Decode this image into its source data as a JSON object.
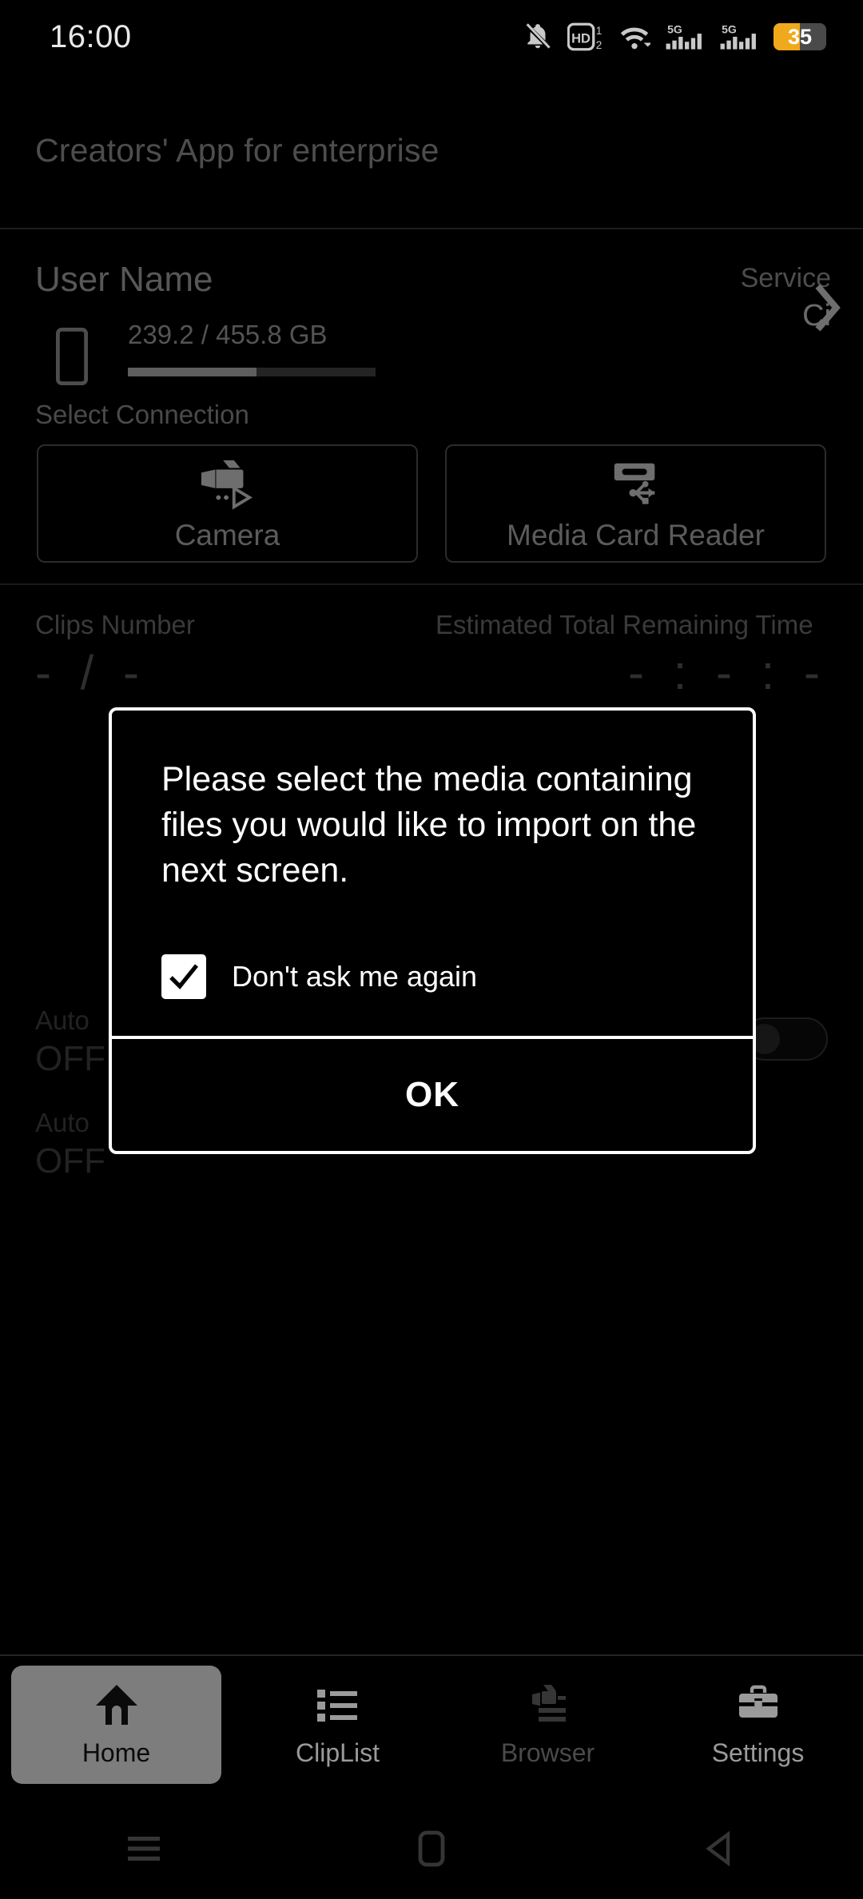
{
  "status_bar": {
    "clock": "16:00",
    "battery_percent": "35",
    "battery_fill_pct": 50,
    "icons": [
      "bell-mute-icon",
      "hd-dual-sim-icon",
      "wifi-icon",
      "signal-5g-icon",
      "signal-5g-icon",
      "battery-icon"
    ],
    "hd_label": "HD",
    "sim_one": "1",
    "sim_two": "2",
    "network_label": "5G",
    "battery_color": "#f0a91c"
  },
  "header": {
    "app_title": "Creators' App for enterprise"
  },
  "user": {
    "name": "User Name",
    "storage_text": "239.2 / 455.8 GB",
    "storage_used_pct": 52,
    "service_label": "Service",
    "service_value": "Ci",
    "chevron_icon": "chevron-right-icon",
    "phone_icon": "phone-storage-icon"
  },
  "connection": {
    "section_label": "Select Connection",
    "options": [
      {
        "label": "Camera",
        "icon": "camcorder-icon"
      },
      {
        "label": "Media Card Reader",
        "icon": "card-reader-usb-icon"
      }
    ]
  },
  "stats": {
    "clips_label": "Clips Number",
    "clips_value": "- / -",
    "time_label": "Estimated Total Remaining Time",
    "time_value": "- : - : -"
  },
  "auto_rows": [
    {
      "label": "Auto",
      "value": "OFF",
      "toggle_state": "off"
    },
    {
      "label": "Auto",
      "value": "OFF",
      "toggle_state": "off"
    }
  ],
  "dialog": {
    "message": "Please select the media containing files you would like to import on the next screen.",
    "checkbox_label": "Don't ask me again",
    "checkbox_checked": true,
    "checkbox_icon": "checkmark-icon",
    "ok_label": "OK",
    "border_color": "#ffffff"
  },
  "bottom_nav": {
    "items": [
      {
        "label": "Home",
        "icon": "home-icon",
        "state": "active"
      },
      {
        "label": "ClipList",
        "icon": "list-icon",
        "state": "normal"
      },
      {
        "label": "Browser",
        "icon": "browser-camera-icon",
        "state": "dimmed"
      },
      {
        "label": "Settings",
        "icon": "toolbox-icon",
        "state": "normal"
      }
    ]
  },
  "android_nav": {
    "items": [
      {
        "icon": "recents-menu-icon"
      },
      {
        "icon": "home-square-icon"
      },
      {
        "icon": "back-triangle-icon"
      }
    ]
  }
}
